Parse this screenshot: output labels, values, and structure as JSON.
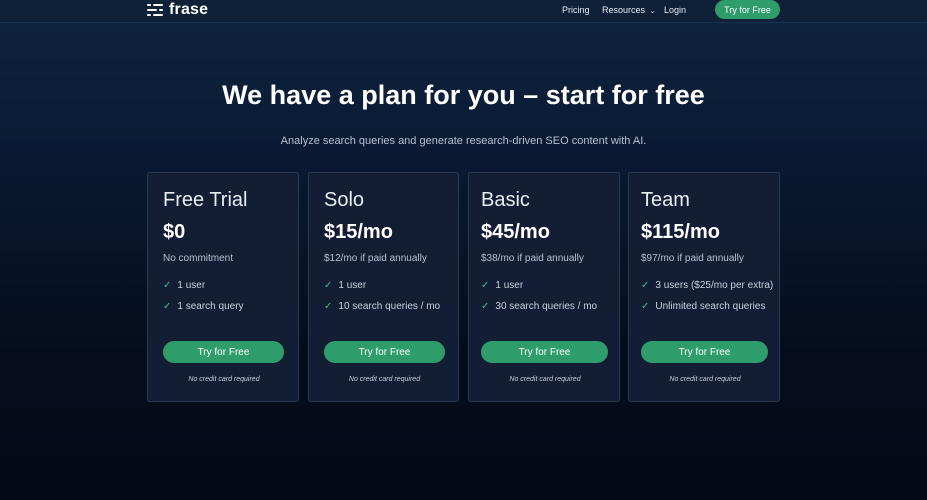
{
  "nav": {
    "brand": "frase",
    "links": [
      "Pricing",
      "Resources",
      "Login"
    ],
    "resources_chevron": "chevron-down-icon",
    "cta": "Try for Free"
  },
  "hero": {
    "title": "We have a plan for you – start for free",
    "subtitle": "Analyze search queries and generate research-driven SEO content with AI."
  },
  "plans": [
    {
      "name": "Free Trial",
      "price": "$0",
      "note": "No commitment",
      "features": [
        "1 user",
        "1 search query"
      ],
      "cta": "Try for Free",
      "footnote": "No credit card required"
    },
    {
      "name": "Solo",
      "price": "$15/mo",
      "note": "$12/mo if paid annually",
      "features": [
        "1 user",
        "10 search queries / mo"
      ],
      "cta": "Try for Free",
      "footnote": "No credit card required"
    },
    {
      "name": "Basic",
      "price": "$45/mo",
      "note": "$38/mo if paid annually",
      "features": [
        "1 user",
        "30 search queries / mo"
      ],
      "cta": "Try for Free",
      "footnote": "No credit card required"
    },
    {
      "name": "Team",
      "price": "$115/mo",
      "note": "$97/mo if paid annually",
      "features": [
        "3 users ($25/mo per extra)",
        "Unlimited search queries"
      ],
      "cta": "Try for Free",
      "footnote": "No credit card required"
    }
  ],
  "colors": {
    "accent": "#2f9c6b",
    "check": "#3fbf85",
    "card_bg": "#131d33",
    "card_border": "#2a3a55"
  }
}
